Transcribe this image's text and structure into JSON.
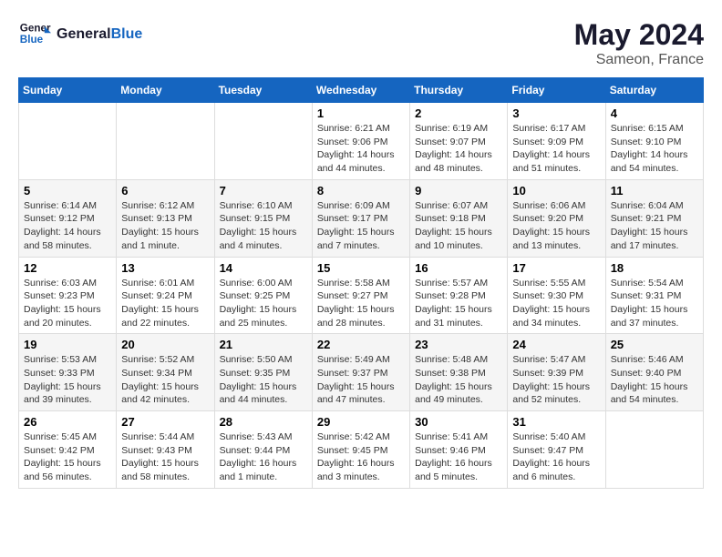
{
  "header": {
    "logo_line1": "General",
    "logo_line2": "Blue",
    "month_year": "May 2024",
    "location": "Sameon, France"
  },
  "days_of_week": [
    "Sunday",
    "Monday",
    "Tuesday",
    "Wednesday",
    "Thursday",
    "Friday",
    "Saturday"
  ],
  "weeks": [
    {
      "shaded": false,
      "days": [
        {
          "num": "",
          "info": ""
        },
        {
          "num": "",
          "info": ""
        },
        {
          "num": "",
          "info": ""
        },
        {
          "num": "1",
          "info": "Sunrise: 6:21 AM\nSunset: 9:06 PM\nDaylight: 14 hours\nand 44 minutes."
        },
        {
          "num": "2",
          "info": "Sunrise: 6:19 AM\nSunset: 9:07 PM\nDaylight: 14 hours\nand 48 minutes."
        },
        {
          "num": "3",
          "info": "Sunrise: 6:17 AM\nSunset: 9:09 PM\nDaylight: 14 hours\nand 51 minutes."
        },
        {
          "num": "4",
          "info": "Sunrise: 6:15 AM\nSunset: 9:10 PM\nDaylight: 14 hours\nand 54 minutes."
        }
      ]
    },
    {
      "shaded": true,
      "days": [
        {
          "num": "5",
          "info": "Sunrise: 6:14 AM\nSunset: 9:12 PM\nDaylight: 14 hours\nand 58 minutes."
        },
        {
          "num": "6",
          "info": "Sunrise: 6:12 AM\nSunset: 9:13 PM\nDaylight: 15 hours\nand 1 minute."
        },
        {
          "num": "7",
          "info": "Sunrise: 6:10 AM\nSunset: 9:15 PM\nDaylight: 15 hours\nand 4 minutes."
        },
        {
          "num": "8",
          "info": "Sunrise: 6:09 AM\nSunset: 9:17 PM\nDaylight: 15 hours\nand 7 minutes."
        },
        {
          "num": "9",
          "info": "Sunrise: 6:07 AM\nSunset: 9:18 PM\nDaylight: 15 hours\nand 10 minutes."
        },
        {
          "num": "10",
          "info": "Sunrise: 6:06 AM\nSunset: 9:20 PM\nDaylight: 15 hours\nand 13 minutes."
        },
        {
          "num": "11",
          "info": "Sunrise: 6:04 AM\nSunset: 9:21 PM\nDaylight: 15 hours\nand 17 minutes."
        }
      ]
    },
    {
      "shaded": false,
      "days": [
        {
          "num": "12",
          "info": "Sunrise: 6:03 AM\nSunset: 9:23 PM\nDaylight: 15 hours\nand 20 minutes."
        },
        {
          "num": "13",
          "info": "Sunrise: 6:01 AM\nSunset: 9:24 PM\nDaylight: 15 hours\nand 22 minutes."
        },
        {
          "num": "14",
          "info": "Sunrise: 6:00 AM\nSunset: 9:25 PM\nDaylight: 15 hours\nand 25 minutes."
        },
        {
          "num": "15",
          "info": "Sunrise: 5:58 AM\nSunset: 9:27 PM\nDaylight: 15 hours\nand 28 minutes."
        },
        {
          "num": "16",
          "info": "Sunrise: 5:57 AM\nSunset: 9:28 PM\nDaylight: 15 hours\nand 31 minutes."
        },
        {
          "num": "17",
          "info": "Sunrise: 5:55 AM\nSunset: 9:30 PM\nDaylight: 15 hours\nand 34 minutes."
        },
        {
          "num": "18",
          "info": "Sunrise: 5:54 AM\nSunset: 9:31 PM\nDaylight: 15 hours\nand 37 minutes."
        }
      ]
    },
    {
      "shaded": true,
      "days": [
        {
          "num": "19",
          "info": "Sunrise: 5:53 AM\nSunset: 9:33 PM\nDaylight: 15 hours\nand 39 minutes."
        },
        {
          "num": "20",
          "info": "Sunrise: 5:52 AM\nSunset: 9:34 PM\nDaylight: 15 hours\nand 42 minutes."
        },
        {
          "num": "21",
          "info": "Sunrise: 5:50 AM\nSunset: 9:35 PM\nDaylight: 15 hours\nand 44 minutes."
        },
        {
          "num": "22",
          "info": "Sunrise: 5:49 AM\nSunset: 9:37 PM\nDaylight: 15 hours\nand 47 minutes."
        },
        {
          "num": "23",
          "info": "Sunrise: 5:48 AM\nSunset: 9:38 PM\nDaylight: 15 hours\nand 49 minutes."
        },
        {
          "num": "24",
          "info": "Sunrise: 5:47 AM\nSunset: 9:39 PM\nDaylight: 15 hours\nand 52 minutes."
        },
        {
          "num": "25",
          "info": "Sunrise: 5:46 AM\nSunset: 9:40 PM\nDaylight: 15 hours\nand 54 minutes."
        }
      ]
    },
    {
      "shaded": false,
      "days": [
        {
          "num": "26",
          "info": "Sunrise: 5:45 AM\nSunset: 9:42 PM\nDaylight: 15 hours\nand 56 minutes."
        },
        {
          "num": "27",
          "info": "Sunrise: 5:44 AM\nSunset: 9:43 PM\nDaylight: 15 hours\nand 58 minutes."
        },
        {
          "num": "28",
          "info": "Sunrise: 5:43 AM\nSunset: 9:44 PM\nDaylight: 16 hours\nand 1 minute."
        },
        {
          "num": "29",
          "info": "Sunrise: 5:42 AM\nSunset: 9:45 PM\nDaylight: 16 hours\nand 3 minutes."
        },
        {
          "num": "30",
          "info": "Sunrise: 5:41 AM\nSunset: 9:46 PM\nDaylight: 16 hours\nand 5 minutes."
        },
        {
          "num": "31",
          "info": "Sunrise: 5:40 AM\nSunset: 9:47 PM\nDaylight: 16 hours\nand 6 minutes."
        },
        {
          "num": "",
          "info": ""
        }
      ]
    }
  ]
}
